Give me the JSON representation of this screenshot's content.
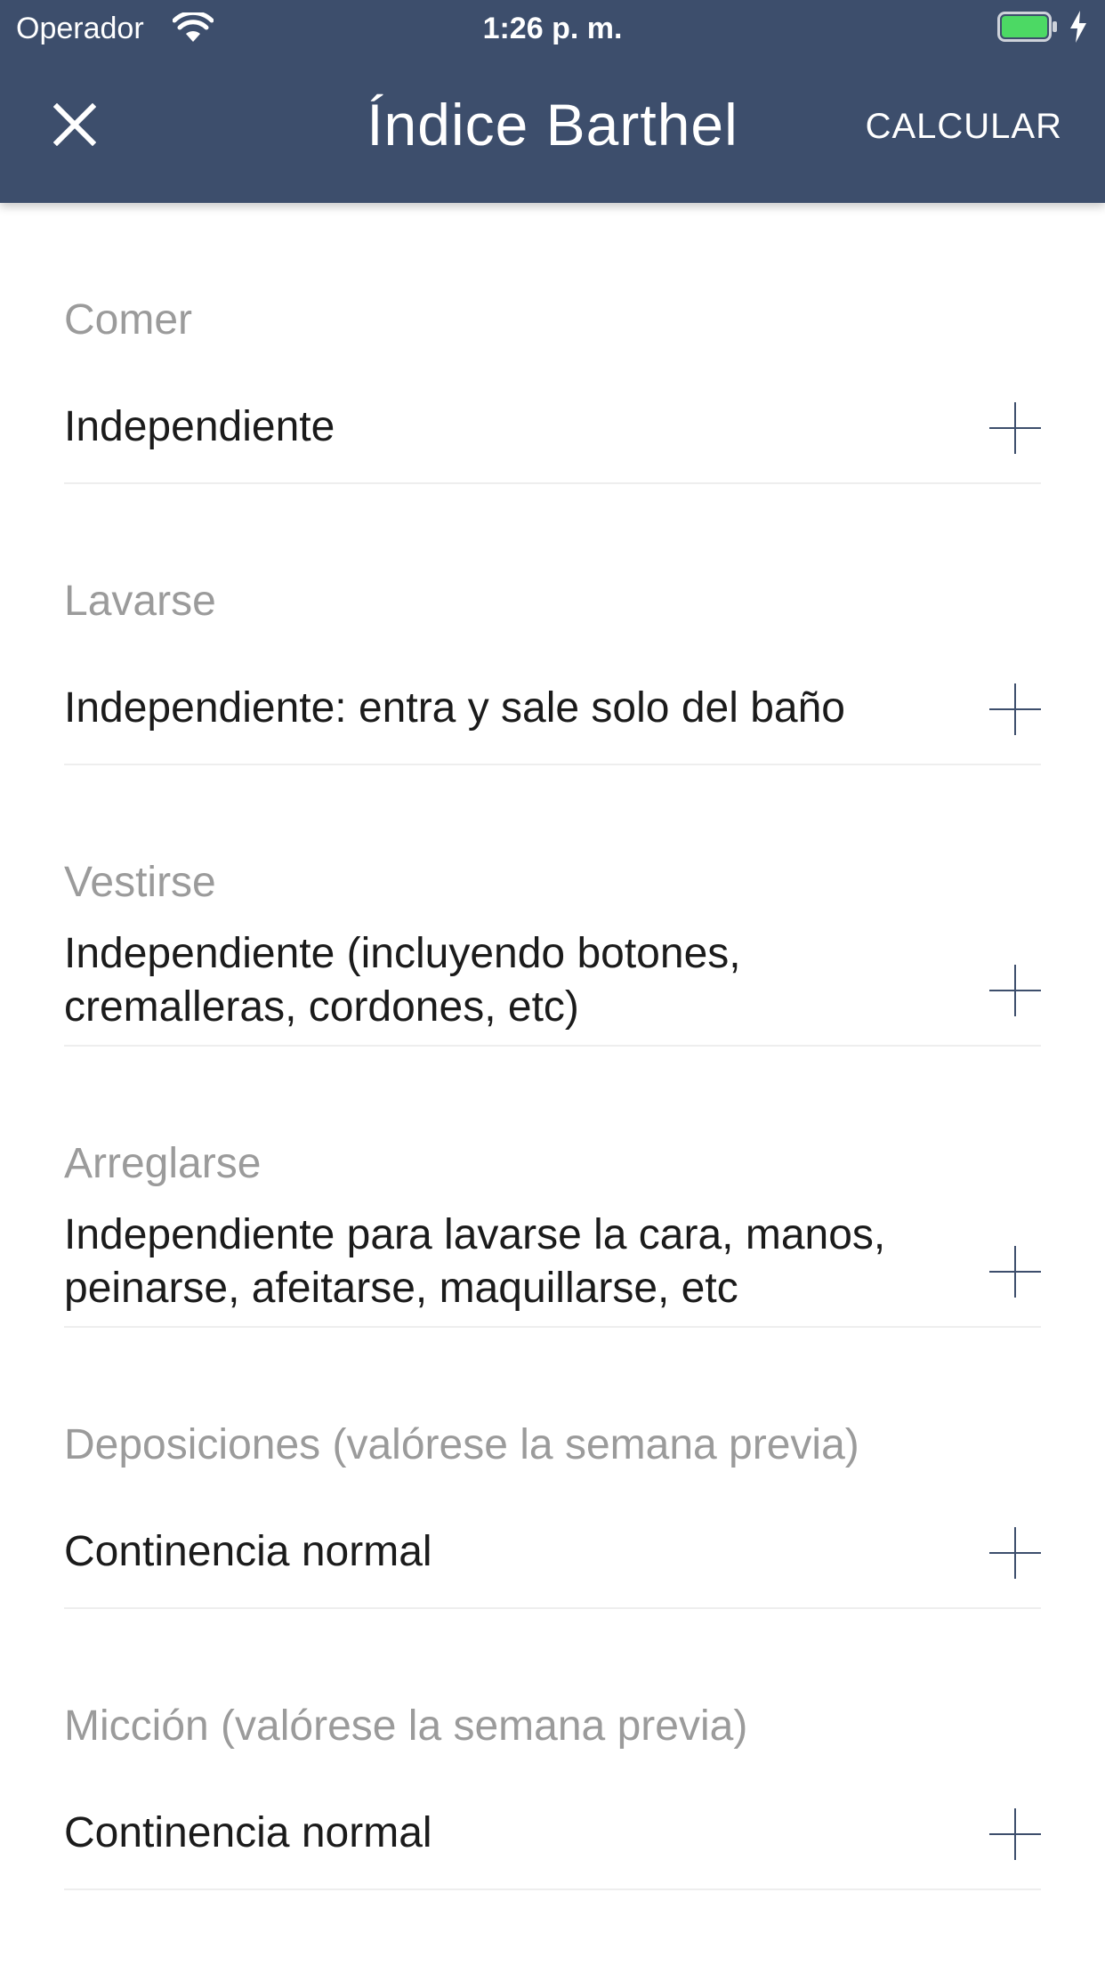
{
  "status_bar": {
    "carrier": "Operador",
    "time": "1:26 p. m.",
    "battery_color": "#4cd964"
  },
  "header": {
    "title": "Índice Barthel",
    "calculate_label": "CALCULAR",
    "background_color": "#3d4e6c"
  },
  "items": [
    {
      "label": "Comer",
      "value": "Independiente"
    },
    {
      "label": "Lavarse",
      "value": "Independiente: entra y sale solo del baño"
    },
    {
      "label": "Vestirse",
      "value": "Independiente (incluyendo botones, cremalleras, cordones, etc)"
    },
    {
      "label": "Arreglarse",
      "value": "Independiente para lavarse la cara, manos, peinarse, afeitarse, maquillarse, etc"
    },
    {
      "label": "Deposiciones (valórese la semana previa)",
      "value": "Continencia normal"
    },
    {
      "label": "Micción (valórese la semana previa)",
      "value": "Continencia normal"
    }
  ]
}
